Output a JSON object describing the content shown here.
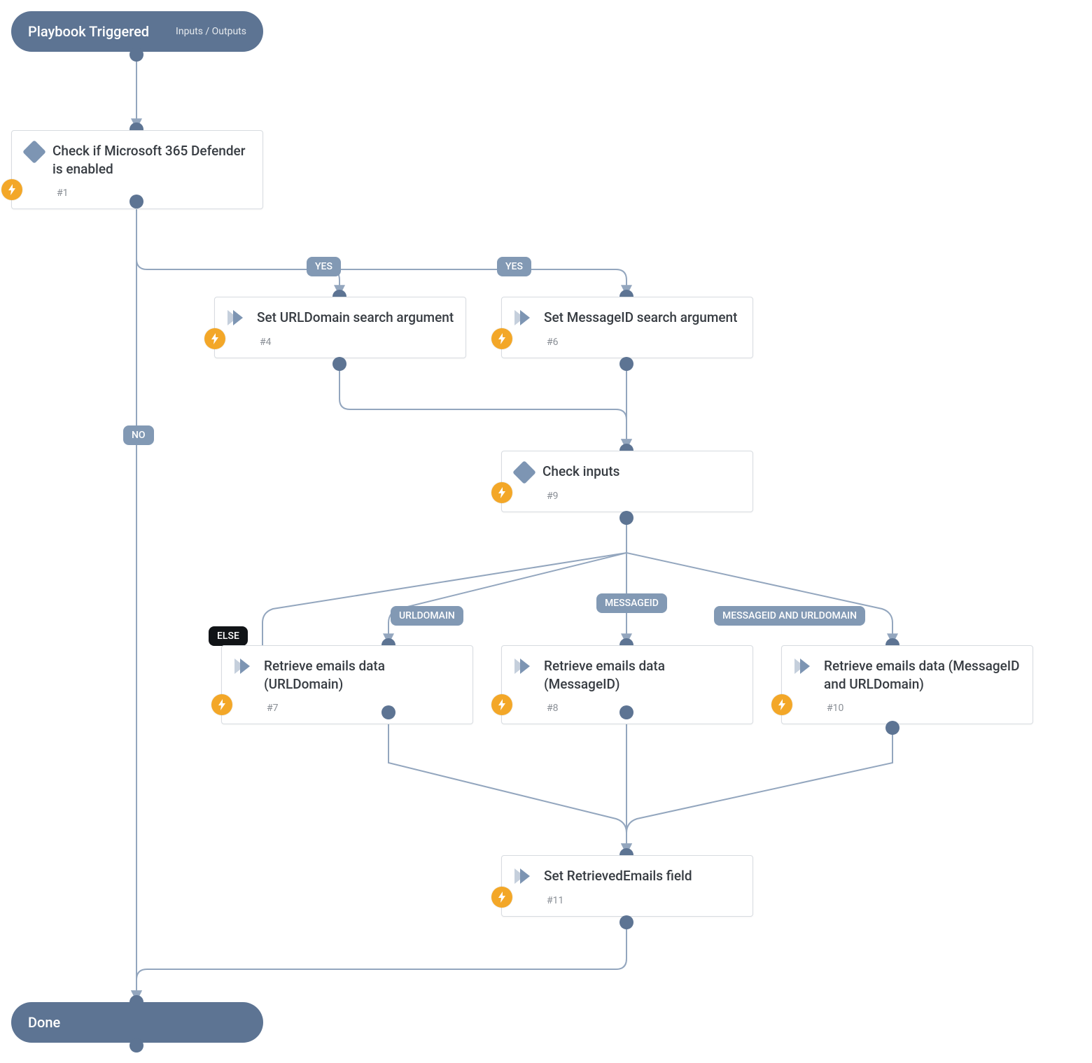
{
  "start": {
    "title": "Playbook Triggered",
    "sub": "Inputs / Outputs"
  },
  "end": {
    "title": "Done"
  },
  "nodes": {
    "n1": {
      "title": "Check if Microsoft 365 Defender is enabled",
      "num": "#1",
      "icon": "diamond"
    },
    "n4": {
      "title": "Set URLDomain search argument",
      "num": "#4",
      "icon": "chev"
    },
    "n6": {
      "title": "Set MessageID search argument",
      "num": "#6",
      "icon": "chev"
    },
    "n9": {
      "title": "Check inputs",
      "num": "#9",
      "icon": "diamond"
    },
    "n7": {
      "title": "Retrieve emails data (URLDomain)",
      "num": "#7",
      "icon": "chev"
    },
    "n8": {
      "title": "Retrieve emails data (MessageID)",
      "num": "#8",
      "icon": "chev"
    },
    "n10": {
      "title": "Retrieve emails data (MessageID and URLDomain)",
      "num": "#10",
      "icon": "chev"
    },
    "n11": {
      "title": "Set RetrievedEmails field",
      "num": "#11",
      "icon": "chev"
    }
  },
  "labels": {
    "yes1": "YES",
    "yes2": "YES",
    "no": "NO",
    "else": "ELSE",
    "urldomain": "URLDOMAIN",
    "messageid": "MESSAGEID",
    "both": "MESSAGEID AND URLDOMAIN"
  }
}
